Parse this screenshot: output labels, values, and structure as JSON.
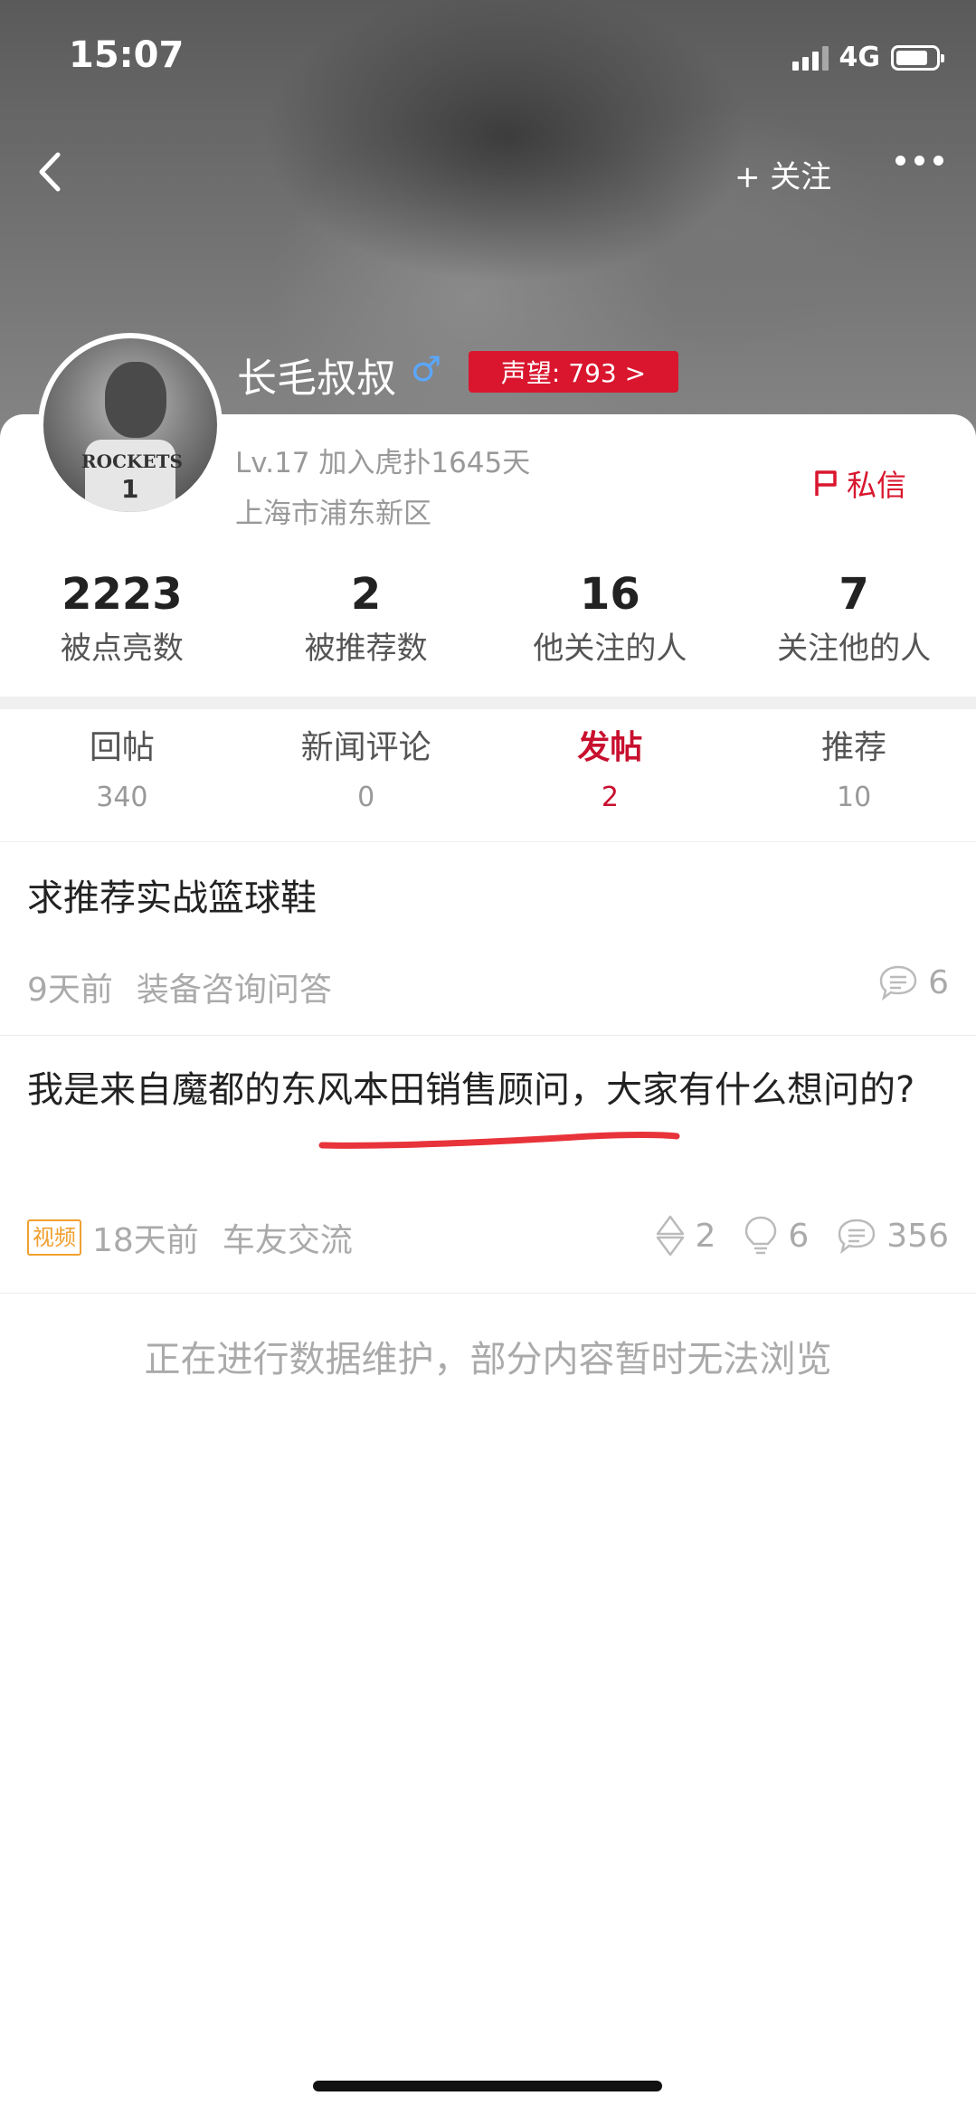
{
  "status_bar": {
    "time": "15:07",
    "network": "4G"
  },
  "nav": {
    "follow_label": "+ 关注"
  },
  "profile": {
    "username": "长毛叔叔",
    "gender_symbol": "♂",
    "reputation_label": "声望: 793 >",
    "avatar_text": "ROCKETS",
    "avatar_number": "1",
    "level_info": "Lv.17 加入虎扑1645天",
    "location": "上海市浦东新区",
    "pm_label": "私信"
  },
  "stats": [
    {
      "value": "2223",
      "label": "被点亮数"
    },
    {
      "value": "2",
      "label": "被推荐数"
    },
    {
      "value": "16",
      "label": "他关注的人"
    },
    {
      "value": "7",
      "label": "关注他的人"
    }
  ],
  "tabs": [
    {
      "label": "回帖",
      "count": "340",
      "active": false
    },
    {
      "label": "新闻评论",
      "count": "0",
      "active": false
    },
    {
      "label": "发帖",
      "count": "2",
      "active": true
    },
    {
      "label": "推荐",
      "count": "10",
      "active": false
    }
  ],
  "posts": [
    {
      "title": "求推荐实战篮球鞋",
      "time": "9天前",
      "board": "装备咨询问答",
      "comments": "6"
    },
    {
      "title": "我是来自魔都的东风本田销售顾问，大家有什么想问的?",
      "tag": "视频",
      "time": "18天前",
      "board": "车友交流",
      "recommends": "2",
      "lights": "6",
      "comments": "356"
    }
  ],
  "notice": "正在进行数据维护，部分内容暂时无法浏览",
  "colors": {
    "accent": "#c8102e",
    "badge": "#d9162e",
    "gender": "#5aa7ff",
    "video_tag": "#f0a030",
    "annotation": "#e8333a"
  }
}
